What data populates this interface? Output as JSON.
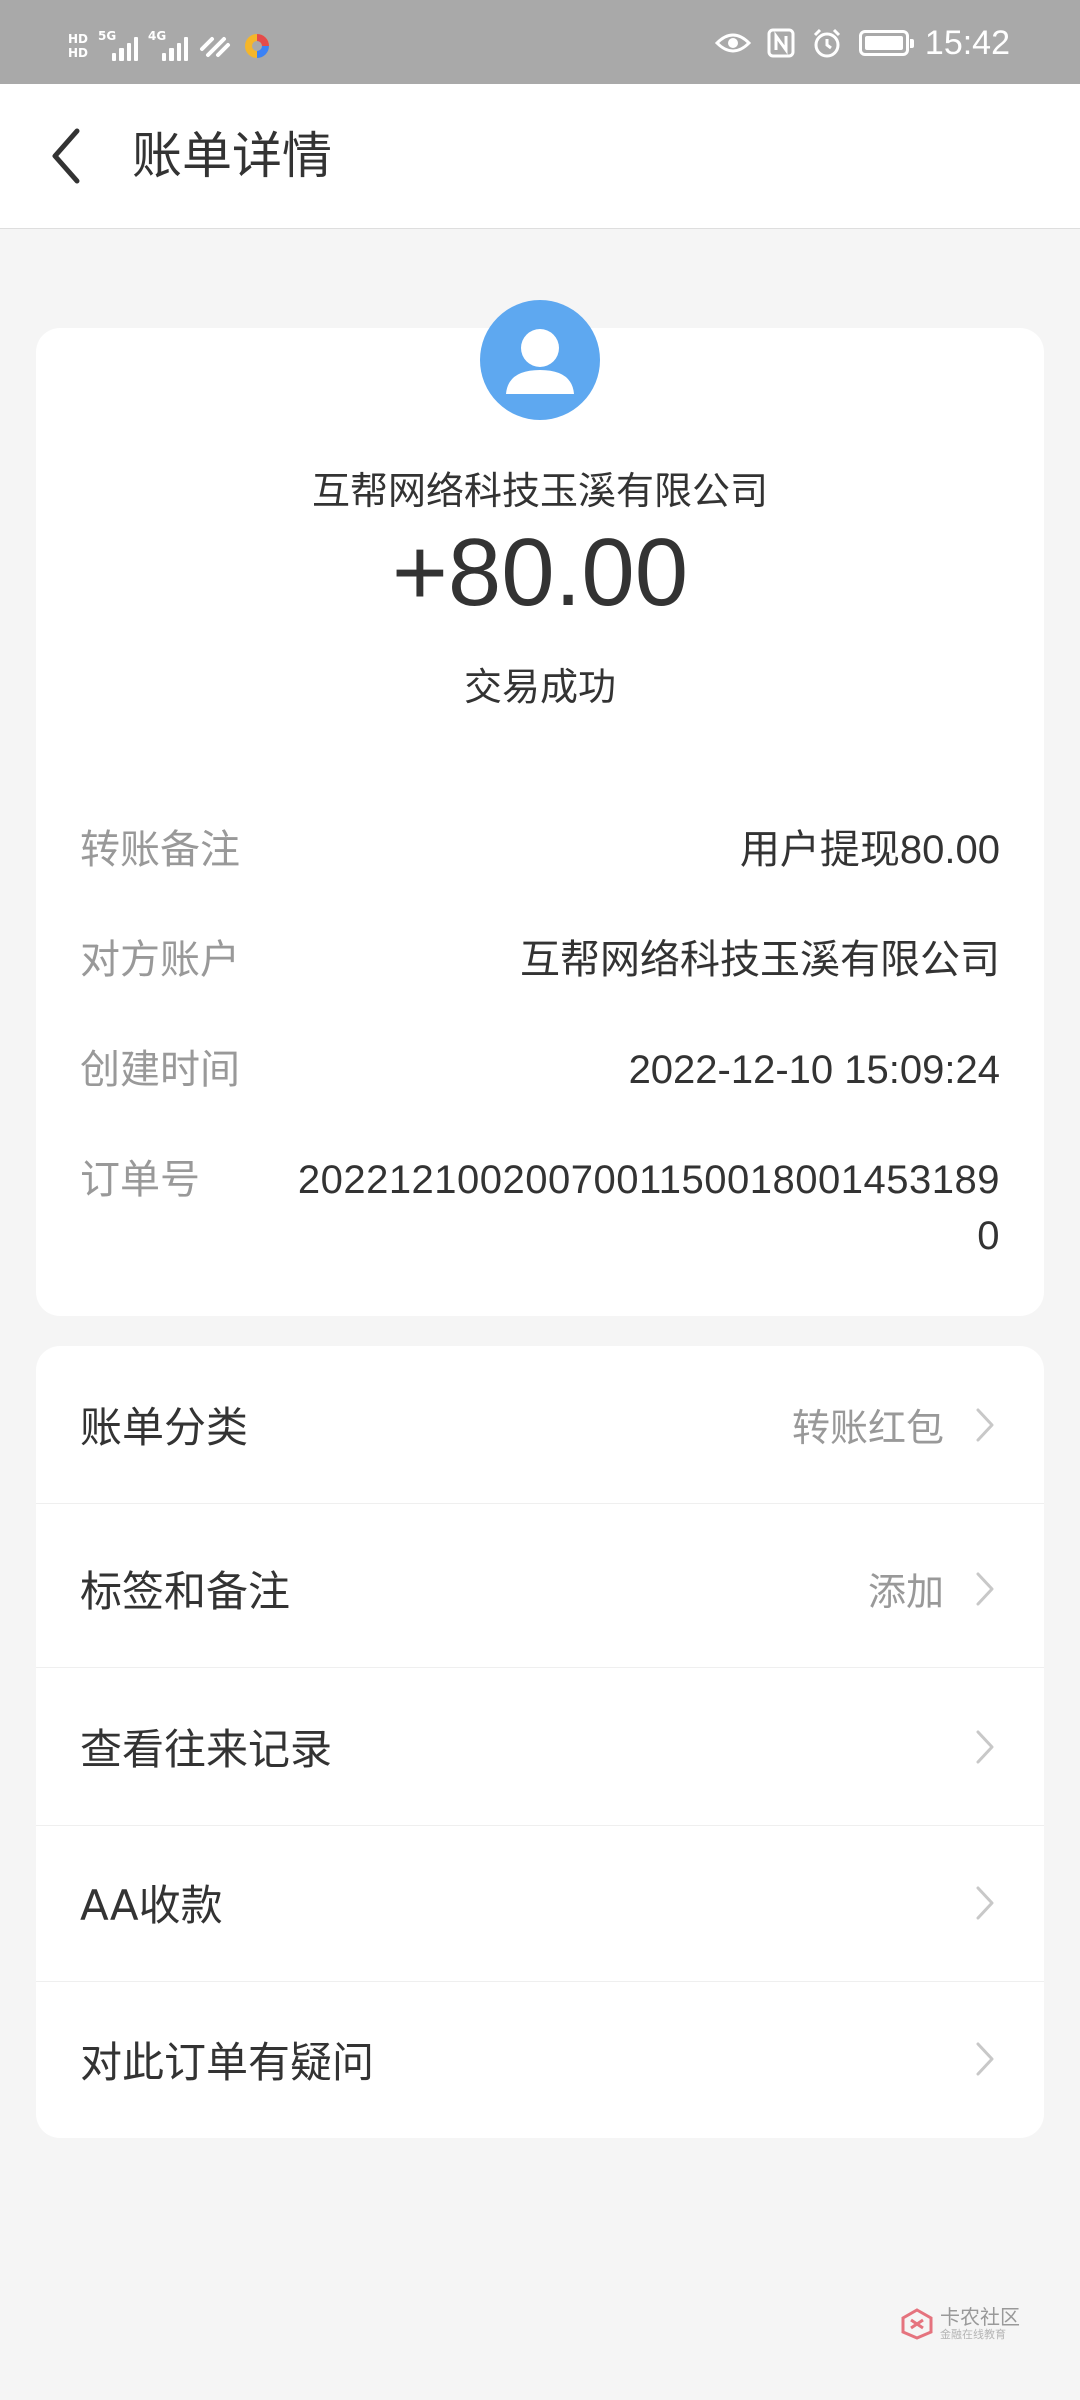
{
  "status_bar": {
    "hd_top": "HD",
    "hd_bottom": "HD",
    "net1": "5G",
    "net2": "4G",
    "time": "15:42"
  },
  "header": {
    "title": "账单详情"
  },
  "transaction": {
    "merchant": "互帮网络科技玉溪有限公司",
    "amount": "+80.00",
    "status": "交易成功"
  },
  "details": [
    {
      "label": "转账备注",
      "value": "用户提现80.00"
    },
    {
      "label": "对方账户",
      "value": "互帮网络科技玉溪有限公司"
    },
    {
      "label": "创建时间",
      "value": "2022-12-10 15:09:24"
    },
    {
      "label": "订单号",
      "value": "20221210020070011500180014531890"
    }
  ],
  "menu": [
    {
      "label": "账单分类",
      "value": "转账红包"
    },
    {
      "label": "标签和备注",
      "value": "添加"
    },
    {
      "label": "查看往来记录",
      "value": ""
    },
    {
      "label": "AA收款",
      "value": ""
    },
    {
      "label": "对此订单有疑问",
      "value": ""
    }
  ],
  "watermark": {
    "main": "卡农社区",
    "sub": "金融在线教育"
  },
  "colors": {
    "status_bar": "#a9a9a9",
    "avatar": "#5ea8f0",
    "label_gray": "#999999",
    "text_dark": "#333333",
    "background": "#f5f5f5"
  }
}
